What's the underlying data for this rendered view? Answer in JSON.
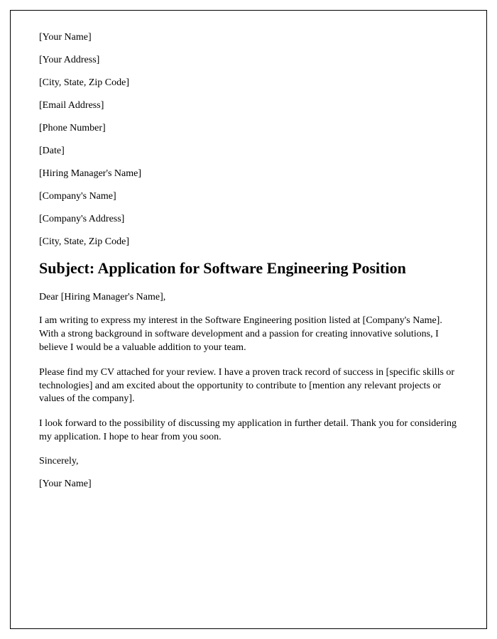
{
  "header": {
    "senderName": "[Your Name]",
    "senderAddress": "[Your Address]",
    "senderCityStateZip": "[City, State, Zip Code]",
    "senderEmail": "[Email Address]",
    "senderPhone": "[Phone Number]",
    "date": "[Date]",
    "recipientName": "[Hiring Manager's Name]",
    "companyName": "[Company's Name]",
    "companyAddress": "[Company's Address]",
    "companyCityStateZip": "[City, State, Zip Code]"
  },
  "subject": "Subject: Application for Software Engineering Position",
  "salutation": "Dear [Hiring Manager's Name],",
  "body": {
    "p1": "I am writing to express my interest in the Software Engineering position listed at [Company's Name]. With a strong background in software development and a passion for creating innovative solutions, I believe I would be a valuable addition to your team.",
    "p2": "Please find my CV attached for your review. I have a proven track record of success in [specific skills or technologies] and am excited about the opportunity to contribute to [mention any relevant projects or values of the company].",
    "p3": "I look forward to the possibility of discussing my application in further detail. Thank you for considering my application. I hope to hear from you soon."
  },
  "closing": "Sincerely,",
  "signature": "[Your Name]"
}
